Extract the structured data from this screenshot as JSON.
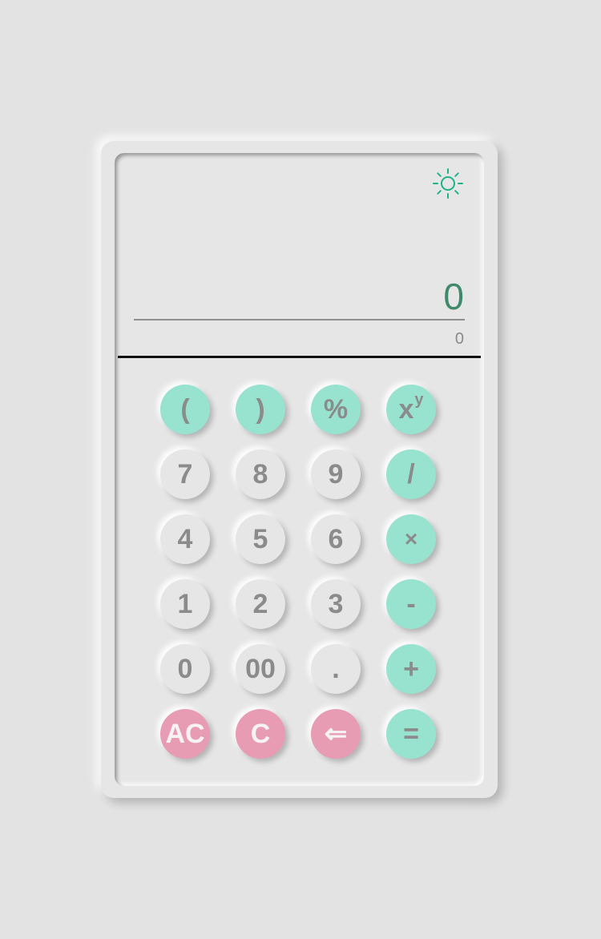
{
  "display": {
    "result": "0",
    "expression": "0",
    "theme_icon": "sun-icon"
  },
  "colors": {
    "accent": "#97e3cf",
    "danger": "#e89cb4",
    "result_text": "#3f8a6a",
    "icon": "#1fb38a"
  },
  "keys": {
    "open_paren": "(",
    "close_paren": ")",
    "percent": "%",
    "power_base": "x",
    "power_exp": "y",
    "seven": "7",
    "eight": "8",
    "nine": "9",
    "divide": "/",
    "four": "4",
    "five": "5",
    "six": "6",
    "multiply": "×",
    "one": "1",
    "two": "2",
    "three": "3",
    "minus": "-",
    "zero": "0",
    "double_zero": "00",
    "decimal": ".",
    "plus": "+",
    "all_clear": "AC",
    "clear": "C",
    "backspace": "⇐",
    "equals": "="
  }
}
